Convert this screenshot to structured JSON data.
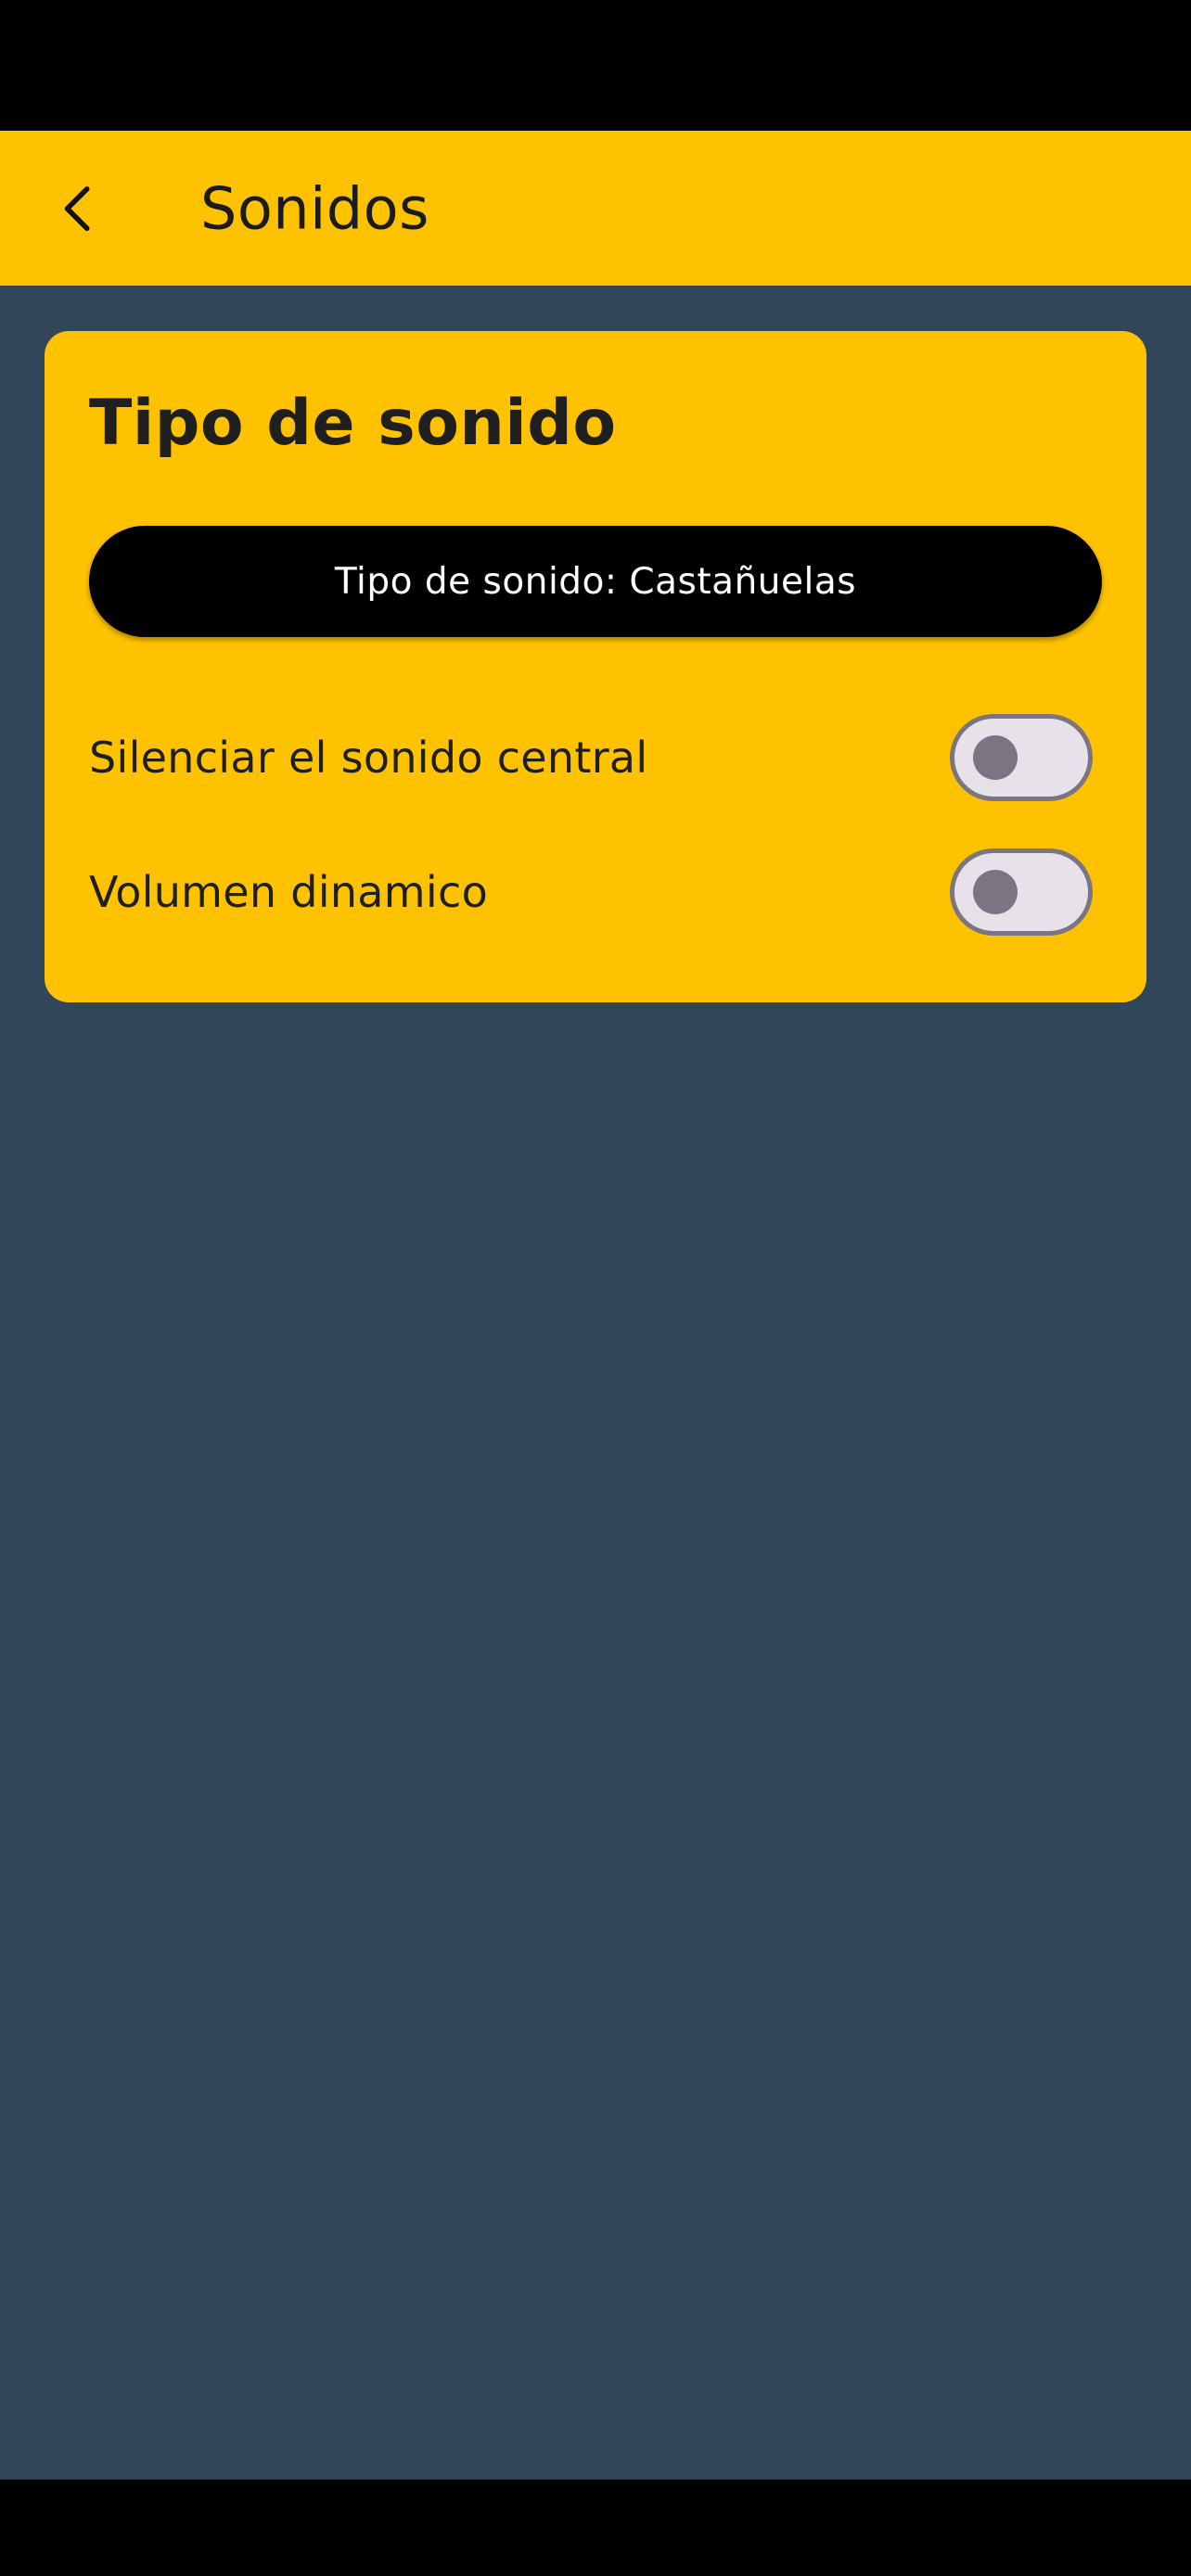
{
  "app_bar": {
    "title": "Sonidos",
    "back_icon": "chevron-left-icon"
  },
  "card": {
    "title": "Tipo de sonido",
    "sound_type_button": "Tipo de sonido: Castañuelas",
    "settings": [
      {
        "label": "Silenciar el sonido central",
        "enabled": false
      },
      {
        "label": "Volumen dinamico",
        "enabled": false
      }
    ]
  },
  "colors": {
    "accent": "#FFC200",
    "background": "#314659",
    "button": "#000000",
    "switch_track": "#E7E2EA",
    "switch_outline": "#7A7580"
  }
}
